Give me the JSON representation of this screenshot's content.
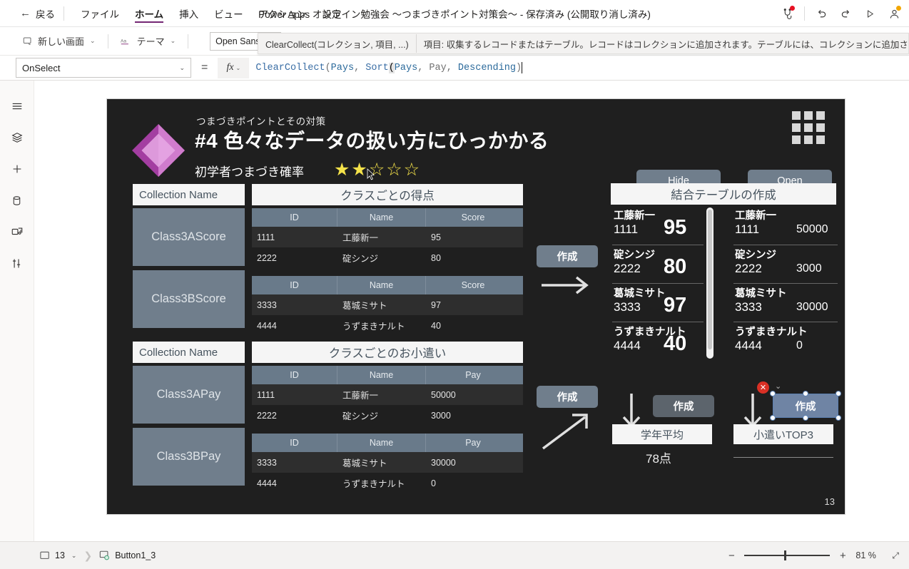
{
  "topbar": {
    "back_label": "戻る",
    "menu": [
      {
        "label": "ファイル",
        "active": false
      },
      {
        "label": "ホーム",
        "active": true
      },
      {
        "label": "挿入",
        "active": false
      },
      {
        "label": "ビュー",
        "active": false
      },
      {
        "label": "アクション",
        "active": false
      },
      {
        "label": "設定",
        "active": false
      }
    ],
    "app_title": "Power Apps オンライン勉強会 ～つまづきポイント対策会～ - 保存済み (公開取り消し済み)",
    "icons": [
      "checker-icon",
      "undo-icon",
      "redo-icon",
      "play-icon",
      "account-icon"
    ]
  },
  "ribbon": {
    "new_screen": "新しい画面",
    "theme": "テーマ",
    "font_value": "Open Sans",
    "intellisense_signature": "ClearCollect(コレクション, 項目, ...)",
    "intellisense_sig_bold": "項目",
    "intellisense_description": "項目: 収集するレコードまたはテーブル。レコードはコレクションに追加されます。テーブルには、コレクションに追加された行が含",
    "intellisense_desc_bold": "項目:"
  },
  "formula_bar": {
    "property": "OnSelect",
    "equals": "=",
    "fx_label": "fx",
    "formula_tokens": [
      {
        "t": "ClearCollect",
        "k": "fn"
      },
      {
        "t": "(",
        "k": "p"
      },
      {
        "t": "Pays",
        "k": "arg"
      },
      {
        "t": ", ",
        "k": "p"
      },
      {
        "t": "Sort",
        "k": "fn"
      },
      {
        "t": "(",
        "k": "hl"
      },
      {
        "t": "Pays",
        "k": "arg"
      },
      {
        "t": ", ",
        "k": "p"
      },
      {
        "t": "Pay",
        "k": "p"
      },
      {
        "t": ", ",
        "k": "p"
      },
      {
        "t": "Descending",
        "k": "arg"
      },
      {
        "t": ")",
        "k": "p"
      }
    ],
    "formula_text": "ClearCollect(Pays, Sort(Pays, Pay, Descending)"
  },
  "rail": {
    "items": [
      {
        "name": "tree-view-icon"
      },
      {
        "name": "layers-icon"
      },
      {
        "name": "insert-plus-icon"
      },
      {
        "name": "data-cylinder-icon"
      },
      {
        "name": "media-icon"
      },
      {
        "name": "variables-icon"
      }
    ]
  },
  "canvas": {
    "header": {
      "kicker": "つまづきポイントとその対策",
      "title": "#4 色々なデータの扱い方にひっかかる",
      "rate_label": "初学者つまづき確率",
      "stars_filled": 2,
      "stars_total": 5,
      "star_filled_glyph": "★",
      "star_empty_glyph": "☆",
      "star_color": "#f5e34a"
    },
    "buttons": {
      "hide": "Hide",
      "open": "Open",
      "create1": "作成",
      "create2": "作成",
      "create3": "作成",
      "create4": "作成"
    },
    "collection_label": "Collection Name",
    "groups": [
      {
        "collection_label": "Collection Name",
        "table_title": "クラスごとの得点",
        "collections": [
          "Class3AScore",
          "Class3BScore"
        ],
        "columns": [
          "ID",
          "Name",
          "Score"
        ],
        "tables": [
          [
            [
              "1111",
              "工藤新一",
              "95"
            ],
            [
              "2222",
              "碇シンジ",
              "80"
            ]
          ],
          [
            [
              "3333",
              "葛城ミサト",
              "97"
            ],
            [
              "4444",
              "うずまきナルト",
              "40"
            ]
          ]
        ]
      },
      {
        "collection_label": "Collection Name",
        "table_title": "クラスごとのお小遣い",
        "collections": [
          "Class3APay",
          "Class3BPay"
        ],
        "columns": [
          "ID",
          "Name",
          "Pay"
        ],
        "tables": [
          [
            [
              "1111",
              "工藤新一",
              "50000"
            ],
            [
              "2222",
              "碇シンジ",
              "3000"
            ]
          ],
          [
            [
              "3333",
              "葛城ミサト",
              "30000"
            ],
            [
              "4444",
              "うずまきナルト",
              "0"
            ]
          ]
        ]
      }
    ],
    "join_panel": {
      "title": "結合テーブルの作成",
      "score_items": [
        {
          "name": "工藤新一",
          "id": "1111",
          "value": "95"
        },
        {
          "name": "碇シンジ",
          "id": "2222",
          "value": "80"
        },
        {
          "name": "葛城ミサト",
          "id": "3333",
          "value": "97"
        },
        {
          "name": "うずまきナルト",
          "id": "4444",
          "value": "40"
        }
      ],
      "pay_items": [
        {
          "name": "工藤新一",
          "id": "1111",
          "value": "50000"
        },
        {
          "name": "碇シンジ",
          "id": "2222",
          "value": "3000"
        },
        {
          "name": "葛城ミサト",
          "id": "3333",
          "value": "30000"
        },
        {
          "name": "うずまきナルト",
          "id": "4444",
          "value": "0"
        }
      ],
      "avg_label": "学年平均",
      "avg_value": "78点",
      "top3_label": "小遣いTOP3"
    },
    "page_number": "13"
  },
  "statusbar": {
    "screen_number": "13",
    "control_name": "Button1_3",
    "zoom_percent": "81",
    "zoom_unit": "%",
    "minus": "−",
    "plus": "+"
  },
  "colors": {
    "accent_purple": "#742774",
    "canvas_bg": "#1f1f1f",
    "button_slate": "#707e8c",
    "header_slate": "#697a8a",
    "selection_blue": "#5b80b2",
    "error_red": "#d93025",
    "star_yellow": "#f5e34a"
  }
}
